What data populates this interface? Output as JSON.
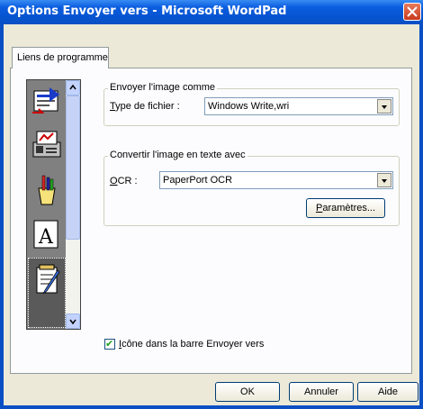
{
  "window": {
    "title": "Options Envoyer vers - Microsoft WordPad"
  },
  "tabs": [
    {
      "label": "Liens de programme"
    }
  ],
  "send_group": {
    "title": "Envoyer l'image comme",
    "file_type_label_first": "T",
    "file_type_label_rest": "ype de fichier :",
    "file_type_value": "Windows Write,wri"
  },
  "ocr_group": {
    "title": "Convertir l'image en texte avec",
    "ocr_label_first": "O",
    "ocr_label_rest": "CR :",
    "ocr_value": "PaperPort OCR",
    "params_first": "P",
    "params_rest": "aramètres..."
  },
  "checkbox": {
    "label_first": "I",
    "label_rest": "cône dans la barre Envoyer vers",
    "checked": true
  },
  "buttons": {
    "ok": "OK",
    "cancel": "Annuler",
    "help": "Aide"
  },
  "program_icons": [
    "outlook-mail-icon",
    "fax-icon",
    "paint-icon",
    "font-icon",
    "wordpad-icon"
  ]
}
